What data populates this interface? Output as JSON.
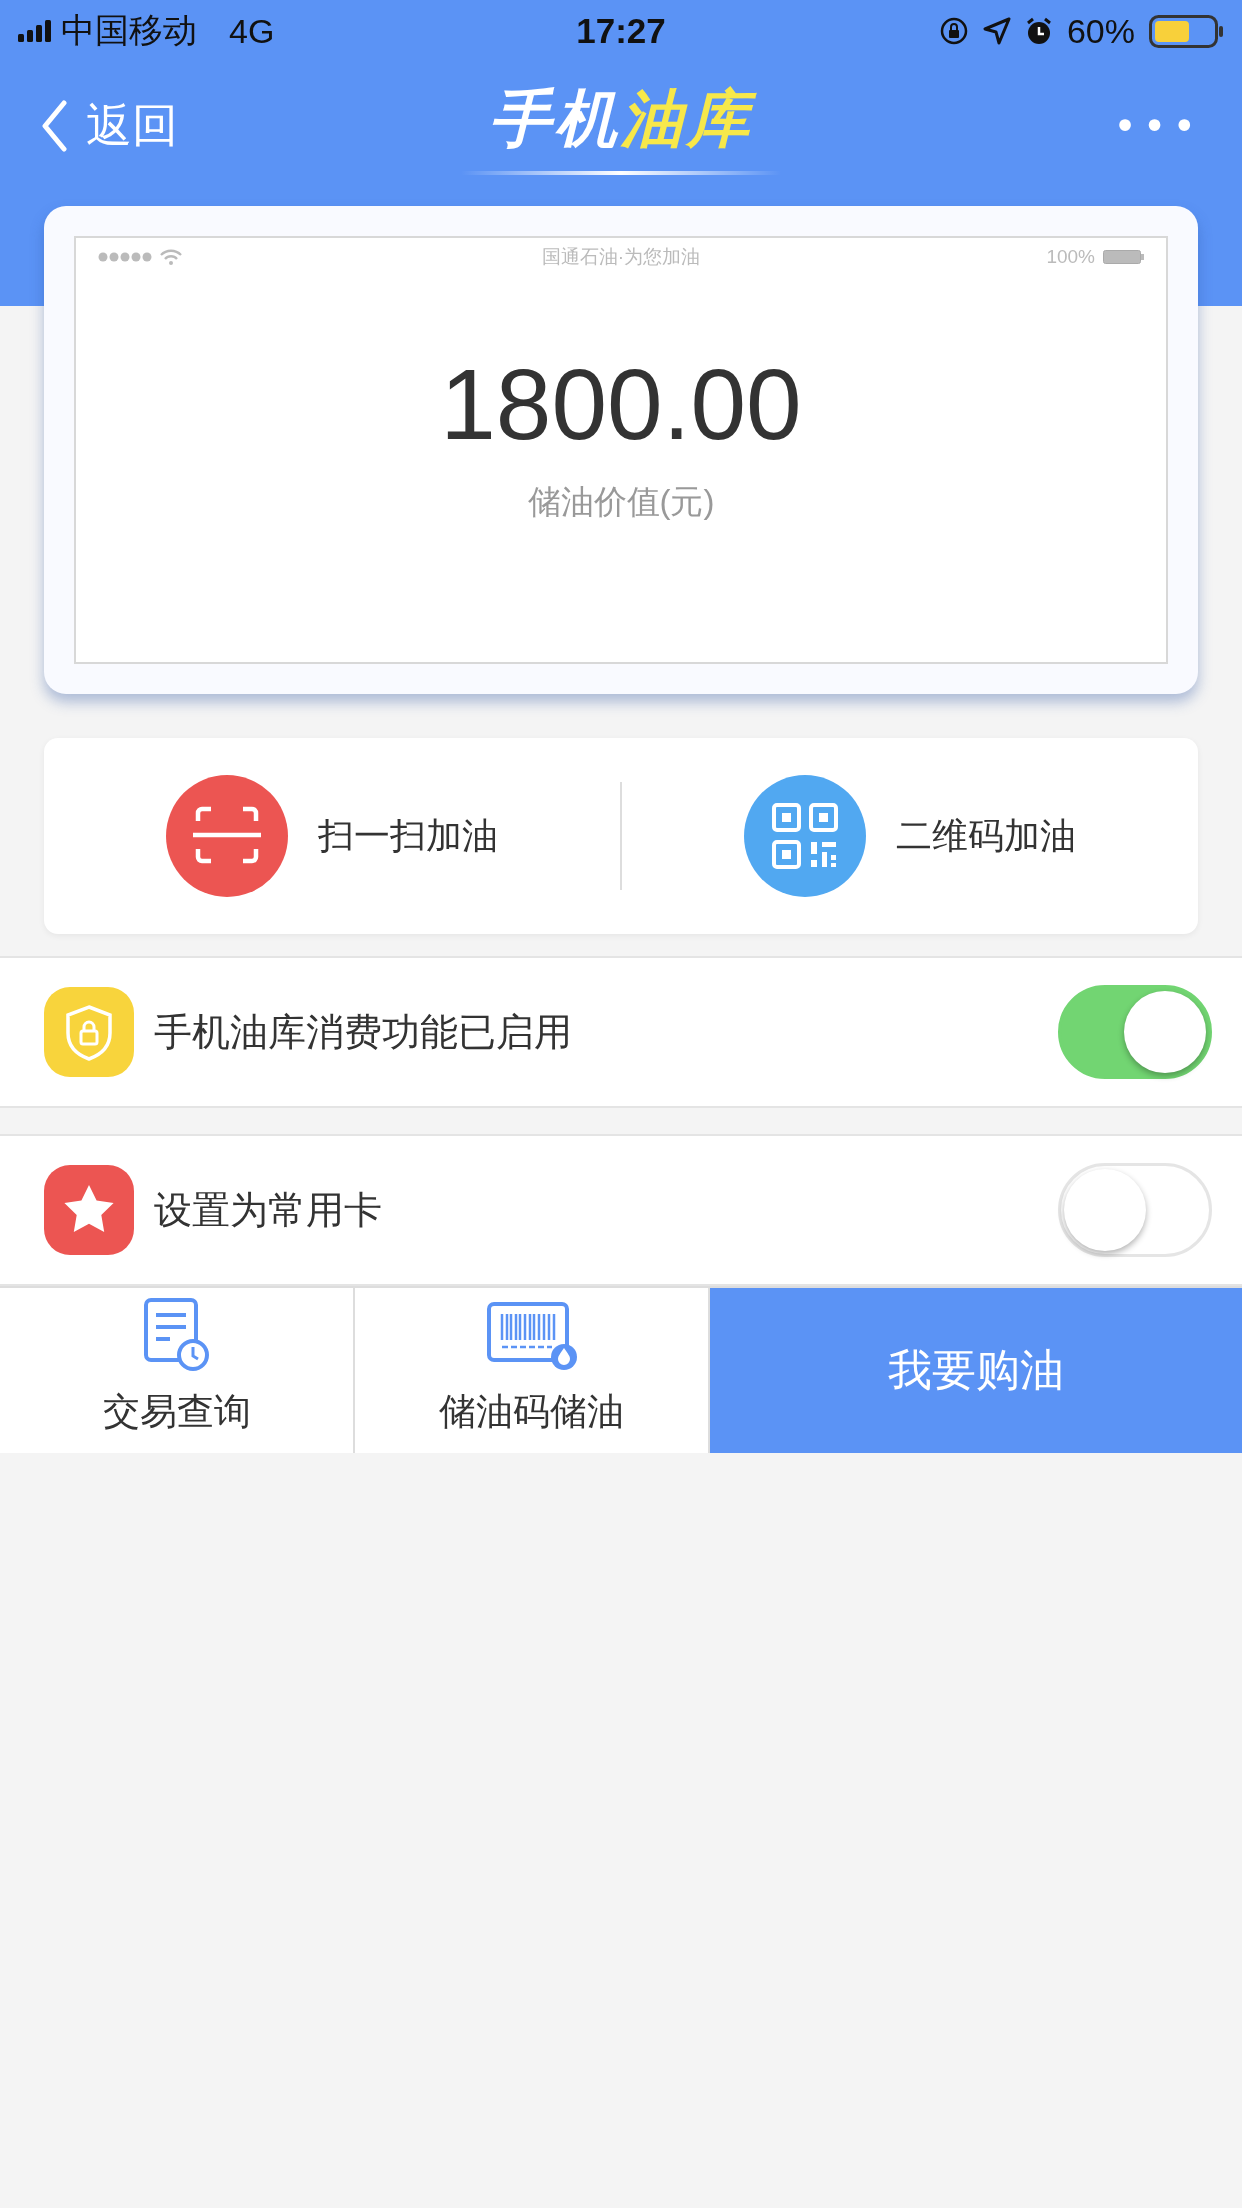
{
  "status_bar": {
    "carrier": "中国移动",
    "network": "4G",
    "time": "17:27",
    "battery": "60%"
  },
  "nav": {
    "back": "返回",
    "title": {
      "text": "手机",
      "highlight": "油库"
    },
    "more": "•••"
  },
  "card": {
    "mock_title": "国通石油·为您加油",
    "mock_battery": "100%",
    "amount": "1800.00",
    "amount_label": "储油价值(元)"
  },
  "actions": [
    {
      "kind": "scan",
      "label": "扫一扫加油"
    },
    {
      "kind": "qr",
      "label": "二维码加油"
    }
  ],
  "settings": [
    {
      "kind": "shield",
      "label": "手机油库消费功能已启用",
      "on": true
    },
    {
      "kind": "star",
      "label": "设置为常用卡",
      "on": false
    }
  ],
  "bottom_bar": [
    {
      "kind": "history",
      "label": "交易查询"
    },
    {
      "kind": "barcode",
      "label": "储油码储油"
    },
    {
      "kind": "primary",
      "label": "我要购油"
    }
  ]
}
